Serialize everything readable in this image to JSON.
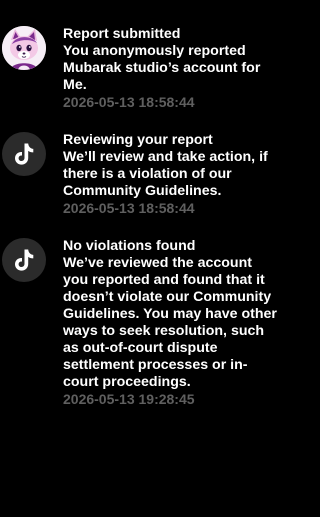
{
  "notifications": [
    {
      "avatar": "user-avatar-cartoon",
      "title": "Report submitted",
      "body": "You anonymously reported Mubarak studio’s account for Me.",
      "time": "2026-05-13 18:58:44"
    },
    {
      "avatar": "tiktok-logo-icon",
      "title": "Reviewing your report",
      "body": "We’ll review and take action, if there is a violation of our Community Guidelines.",
      "time": "2026-05-13 18:58:44"
    },
    {
      "avatar": "tiktok-logo-icon",
      "title": "No violations found",
      "body": "We’ve reviewed the account you reported and found that it doesn’t violate our Community Guidelines. You may have other ways to seek resolution, such as out-of-court dispute settlement processes or in-court proceedings.",
      "time": "2026-05-13 19:28:45"
    }
  ],
  "colors": {
    "background": "#000000",
    "text": "#ffffff",
    "timestamp": "#5f5f5f",
    "icon_circle": "#2b2b2b"
  }
}
